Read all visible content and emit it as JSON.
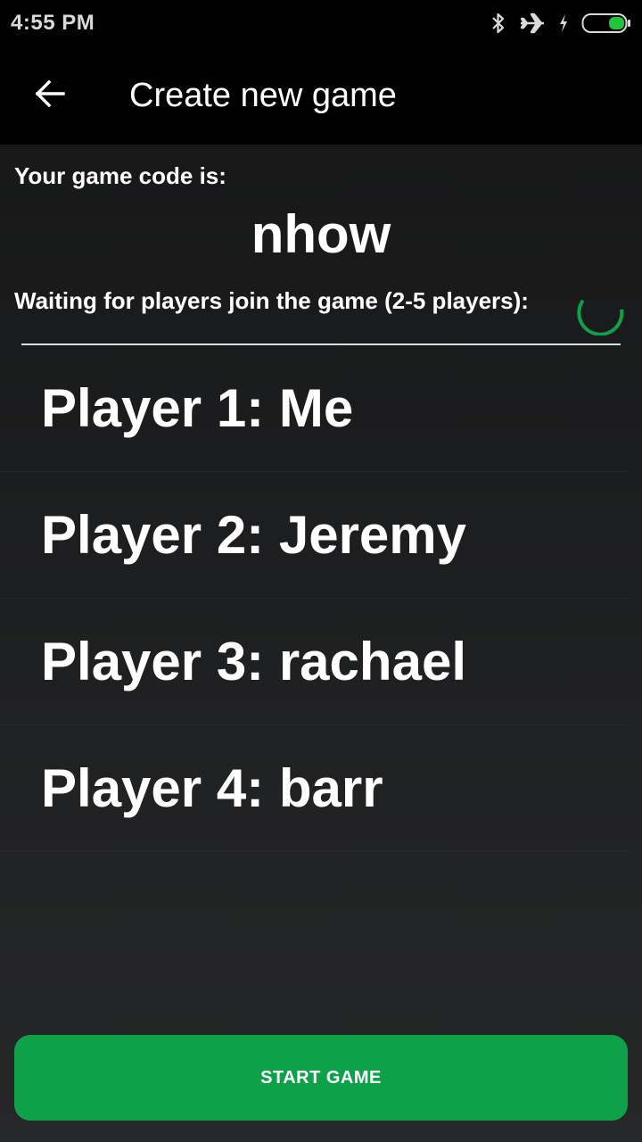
{
  "status_bar": {
    "time": "4:55 PM",
    "icons": [
      "bluetooth-icon",
      "airplane-mode-icon",
      "charging-icon",
      "battery-icon"
    ],
    "battery_color": "#22c43a"
  },
  "app_bar": {
    "title": "Create new game",
    "back_icon": "arrow-left-icon"
  },
  "game": {
    "code_label": "Your game code is:",
    "code": "nhow",
    "waiting_text": "Waiting for players join the game (2-5 players):",
    "spinner_color": "#0fa14a"
  },
  "players": [
    {
      "label": "Player 1: Me"
    },
    {
      "label": "Player 2: Jeremy"
    },
    {
      "label": "Player 3: rachael"
    },
    {
      "label": "Player 4: barr"
    }
  ],
  "start_button": {
    "label": "START GAME",
    "color": "#0fa14a"
  }
}
